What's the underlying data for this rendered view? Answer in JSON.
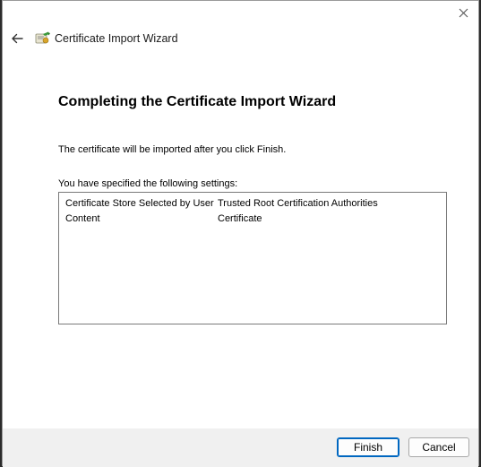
{
  "window": {
    "title": "Certificate Import Wizard"
  },
  "icons": {
    "close": "close-icon",
    "back": "back-arrow-icon",
    "app": "certificate-icon"
  },
  "page": {
    "heading": "Completing the Certificate Import Wizard",
    "info": "The certificate will be imported after you click Finish.",
    "settings_label": "You have specified the following settings:"
  },
  "settings": [
    {
      "key": "Certificate Store Selected by User",
      "value": "Trusted Root Certification Authorities"
    },
    {
      "key": "Content",
      "value": "Certificate"
    }
  ],
  "buttons": {
    "finish": "Finish",
    "cancel": "Cancel"
  },
  "colors": {
    "accent": "#0067c0",
    "footer_bg": "#f0f0f0"
  }
}
